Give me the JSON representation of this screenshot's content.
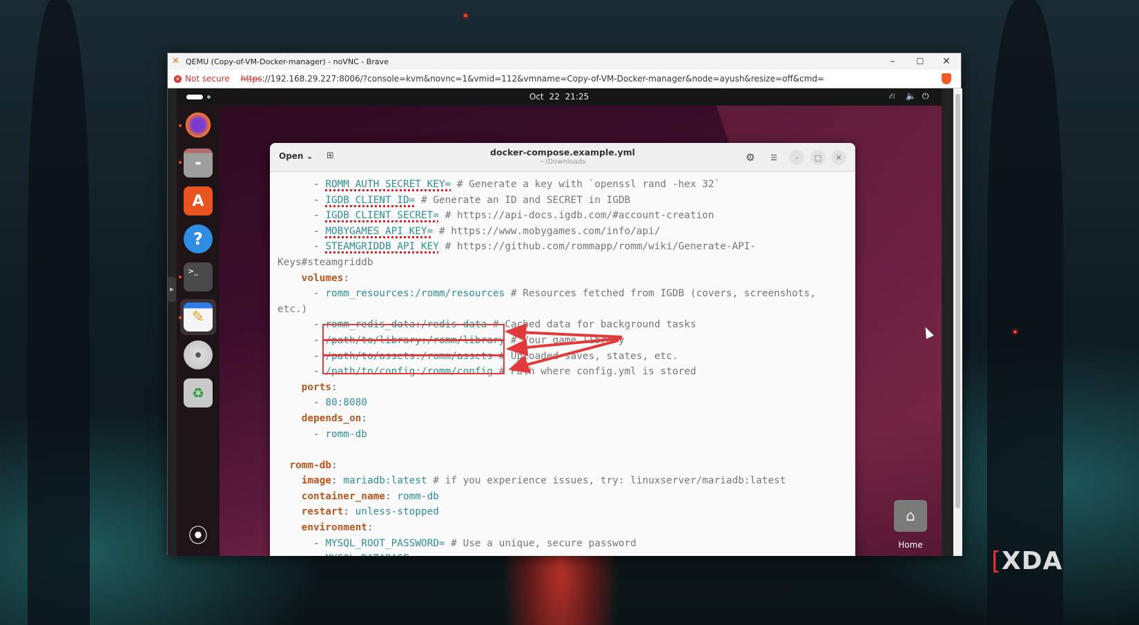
{
  "browser": {
    "title": "QEMU (Copy-of-VM-Docker-manager) - noVNC - Brave",
    "not_secure": "Not secure",
    "url_scheme": "https",
    "url_rest": "://192.168.29.227:8006/?console=kvm&novnc=1&vmid=112&vmname=Copy-of-VM-Docker-manager&node=ayush&resize=off&cmd=",
    "minimize": "–",
    "maximize": "☐",
    "close": "✕"
  },
  "ubuntu": {
    "clock": "Oct 22  21:25",
    "tray": {
      "network": "⛙",
      "volume": "🔈",
      "power": "⏻"
    },
    "dock": [
      {
        "name": "firefox",
        "glyph": "🦊"
      },
      {
        "name": "files",
        "glyph": "▬"
      },
      {
        "name": "app-center",
        "glyph": "A"
      },
      {
        "name": "help",
        "glyph": "?"
      },
      {
        "name": "terminal",
        "glyph": ">_"
      },
      {
        "name": "text-editor",
        "glyph": "✎"
      },
      {
        "name": "disc",
        "glyph": "◉"
      },
      {
        "name": "trash",
        "glyph": "♻"
      },
      {
        "name": "show-apps",
        "glyph": "⦿"
      }
    ],
    "desktop_home_label": "Home"
  },
  "editor": {
    "open_label": "Open ⌄",
    "new_tab": "⊞",
    "filename": "docker-compose.example.yml",
    "path": "~/Downloads",
    "gear": "⚙",
    "menu": "☰",
    "min": "–",
    "max": "□",
    "close": "✕",
    "lines": [
      [
        {
          "t": "      - ",
          "c": "p"
        },
        {
          "t": "ROMM_AUTH_SECRET_KEY=",
          "c": "v sp"
        },
        {
          "t": " # Generate a key with `openssl rand -hex 32`",
          "c": "c"
        }
      ],
      [
        {
          "t": "      - ",
          "c": "p"
        },
        {
          "t": "IGDB_CLIENT_ID=",
          "c": "v sp"
        },
        {
          "t": " # Generate an ID and SECRET in IGDB",
          "c": "c"
        }
      ],
      [
        {
          "t": "      - ",
          "c": "p"
        },
        {
          "t": "IGDB_CLIENT_SECRET=",
          "c": "v sp"
        },
        {
          "t": " # https://api-docs.igdb.com/#account-creation",
          "c": "c"
        }
      ],
      [
        {
          "t": "      - ",
          "c": "p"
        },
        {
          "t": "MOBYGAMES_API_KEY=",
          "c": "v sp"
        },
        {
          "t": " # https://www.mobygames.com/info/api/",
          "c": "c"
        }
      ],
      [
        {
          "t": "      - ",
          "c": "p"
        },
        {
          "t": "STEAMGRIDDB_API_KEY",
          "c": "v sp"
        },
        {
          "t": " # https://github.com/rommapp/romm/wiki/Generate-API-",
          "c": "c"
        }
      ],
      [
        {
          "t": "Keys#steamgriddb",
          "c": "c"
        }
      ],
      [
        {
          "t": "    ",
          "c": "p"
        },
        {
          "t": "volumes",
          "c": "k"
        },
        {
          "t": ":",
          "c": "p"
        }
      ],
      [
        {
          "t": "      - ",
          "c": "p"
        },
        {
          "t": "romm_resources:/romm/resources",
          "c": "v"
        },
        {
          "t": " # Resources fetched from IGDB (covers, screenshots,",
          "c": "c"
        }
      ],
      [
        {
          "t": "etc.)",
          "c": "c"
        }
      ],
      [
        {
          "t": "      - ",
          "c": "p"
        },
        {
          "t": "romm_redis_data:/redis-data",
          "c": "v"
        },
        {
          "t": " # Cached data for background tasks",
          "c": "c"
        }
      ],
      [
        {
          "t": "      - ",
          "c": "p"
        },
        {
          "t": "/path/to/library:/romm/library",
          "c": "v"
        },
        {
          "t": " # Your game library",
          "c": "c"
        }
      ],
      [
        {
          "t": "      - ",
          "c": "p"
        },
        {
          "t": "/path/to/assets:/romm/assets",
          "c": "v"
        },
        {
          "t": " # Uploaded saves, states, etc.",
          "c": "c"
        }
      ],
      [
        {
          "t": "      - ",
          "c": "p"
        },
        {
          "t": "/path/to/config:/romm/config",
          "c": "v"
        },
        {
          "t": " # Path where config.yml is stored",
          "c": "c"
        }
      ],
      [
        {
          "t": "    ",
          "c": "p"
        },
        {
          "t": "ports",
          "c": "k"
        },
        {
          "t": ":",
          "c": "p"
        }
      ],
      [
        {
          "t": "      - ",
          "c": "p"
        },
        {
          "t": "80:8080",
          "c": "v"
        }
      ],
      [
        {
          "t": "    ",
          "c": "p"
        },
        {
          "t": "depends_on",
          "c": "k"
        },
        {
          "t": ":",
          "c": "p"
        }
      ],
      [
        {
          "t": "      - ",
          "c": "p"
        },
        {
          "t": "romm-db",
          "c": "v"
        }
      ],
      [
        {
          "t": " ",
          "c": "p"
        }
      ],
      [
        {
          "t": "  ",
          "c": "p"
        },
        {
          "t": "romm-db",
          "c": "k"
        },
        {
          "t": ":",
          "c": "p"
        }
      ],
      [
        {
          "t": "    ",
          "c": "p"
        },
        {
          "t": "image",
          "c": "k"
        },
        {
          "t": ": ",
          "c": "p"
        },
        {
          "t": "mariadb:latest",
          "c": "v"
        },
        {
          "t": " # if you experience issues, try: linuxserver/mariadb:latest",
          "c": "c"
        }
      ],
      [
        {
          "t": "    ",
          "c": "p"
        },
        {
          "t": "container_name",
          "c": "k"
        },
        {
          "t": ": ",
          "c": "p"
        },
        {
          "t": "romm-db",
          "c": "v"
        }
      ],
      [
        {
          "t": "    ",
          "c": "p"
        },
        {
          "t": "restart",
          "c": "k"
        },
        {
          "t": ": ",
          "c": "p"
        },
        {
          "t": "unless-stopped",
          "c": "v"
        }
      ],
      [
        {
          "t": "    ",
          "c": "p"
        },
        {
          "t": "environment",
          "c": "k"
        },
        {
          "t": ":",
          "c": "p"
        }
      ],
      [
        {
          "t": "      - ",
          "c": "p"
        },
        {
          "t": "MYSQL_ROOT_PASSWORD=",
          "c": "v"
        },
        {
          "t": " # Use a unique, secure password",
          "c": "c"
        }
      ],
      [
        {
          "t": "      - ",
          "c": "p"
        },
        {
          "t": "MYSQL_DATABASE=romm",
          "c": "v"
        }
      ]
    ]
  },
  "watermark": {
    "text": "XDA",
    "bracket": "[ ]"
  },
  "colors": {
    "annotation": "#e23a3a",
    "key": "#b8561e",
    "value": "#2f8f93"
  }
}
